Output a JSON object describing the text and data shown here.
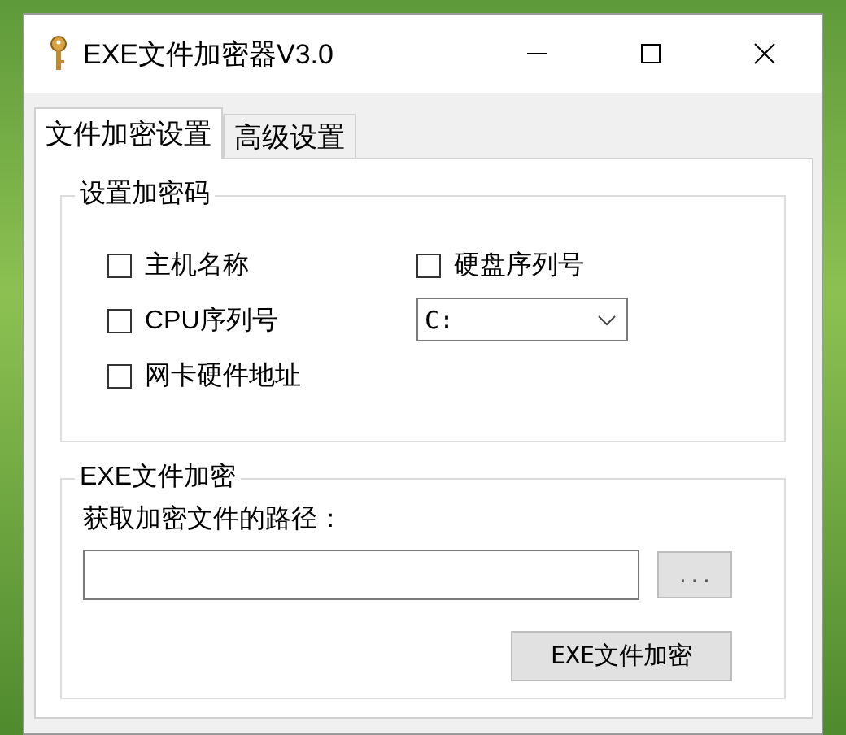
{
  "window": {
    "title": "EXE文件加密器V3.0"
  },
  "tabs": [
    {
      "label": "文件加密设置",
      "selected": true
    },
    {
      "label": "高级设置",
      "selected": false
    }
  ],
  "password_group": {
    "title": "设置加密码",
    "options": [
      {
        "label": "主机名称",
        "checked": false
      },
      {
        "label": "CPU序列号",
        "checked": false
      },
      {
        "label": "网卡硬件地址",
        "checked": false
      },
      {
        "label": "硬盘序列号",
        "checked": false
      }
    ],
    "drive_select": {
      "value": "C:"
    }
  },
  "encrypt_group": {
    "title": "EXE文件加密",
    "path_label": "获取加密文件的路径：",
    "browse_button": "...",
    "encrypt_button": "EXE文件加密"
  }
}
